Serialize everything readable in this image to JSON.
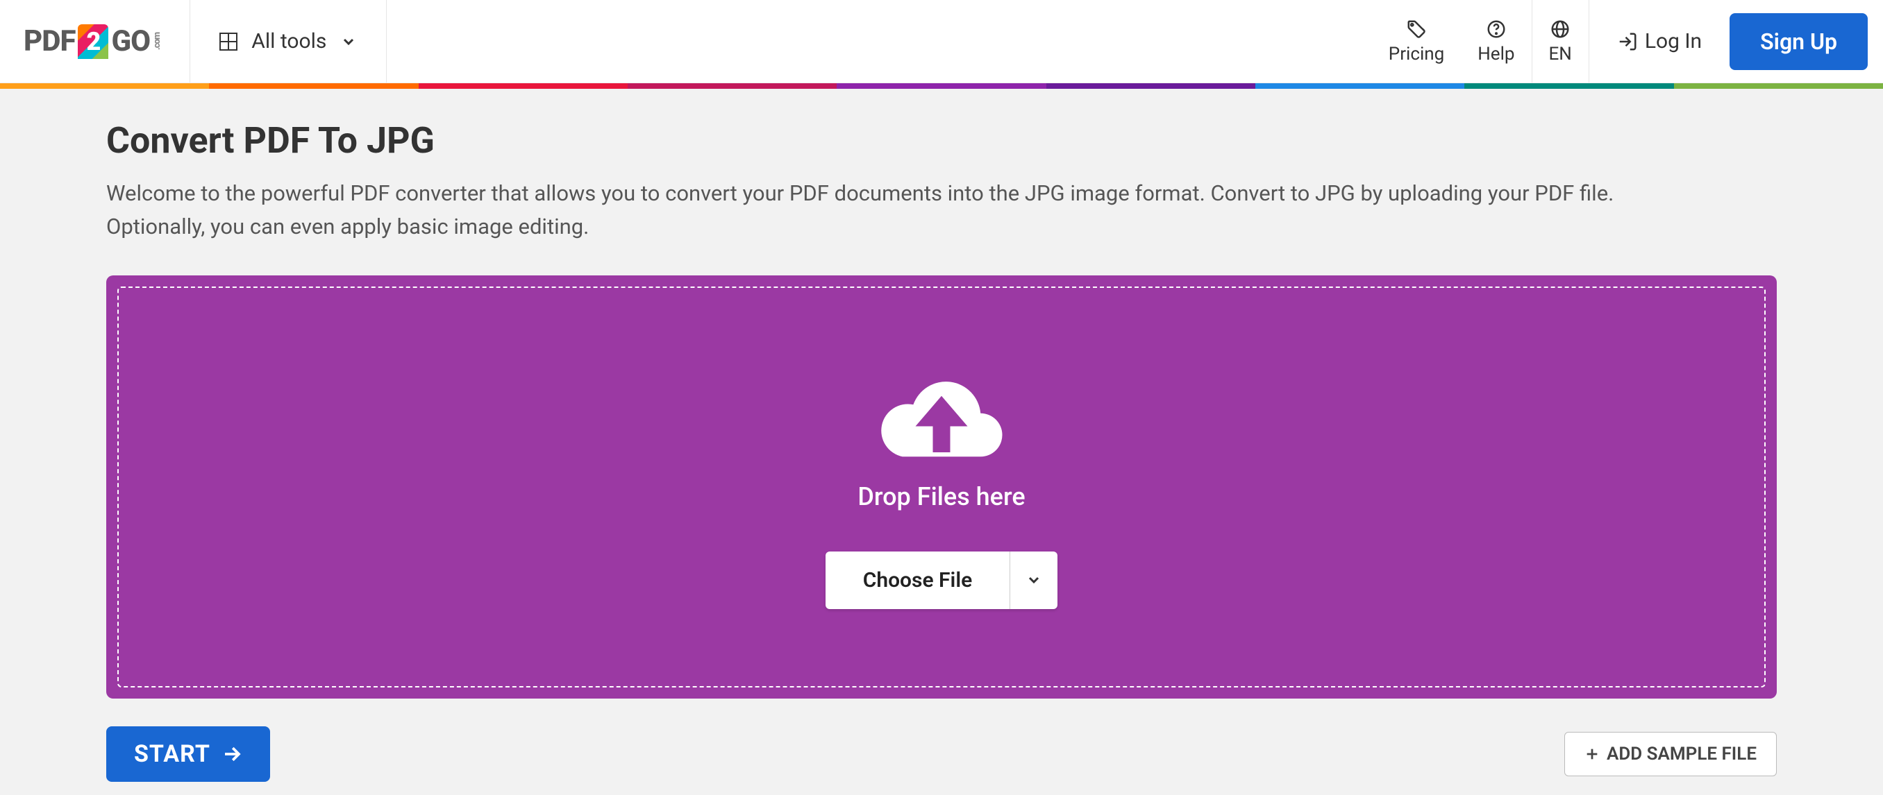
{
  "header": {
    "logo_pdf": "PDF",
    "logo_2": "2",
    "logo_go": "GO",
    "logo_com": ".com",
    "all_tools": "All tools",
    "pricing": "Pricing",
    "help": "Help",
    "language": "EN",
    "login": "Log In",
    "signup": "Sign Up"
  },
  "rainbow_colors": [
    "#ff9f1a",
    "#ff6b00",
    "#e8163c",
    "#c2185b",
    "#8e24aa",
    "#6a1b9a",
    "#1e88e5",
    "#00897b",
    "#7cb342"
  ],
  "page": {
    "title": "Convert PDF To JPG",
    "description": "Welcome to the powerful PDF converter that allows you to convert your PDF documents into the JPG image format. Convert to JPG by uploading your PDF file. Optionally, you can even apply basic image editing."
  },
  "dropzone": {
    "drop_text": "Drop Files here",
    "choose_file": "Choose File"
  },
  "actions": {
    "start": "START",
    "add_sample": "ADD SAMPLE FILE"
  }
}
